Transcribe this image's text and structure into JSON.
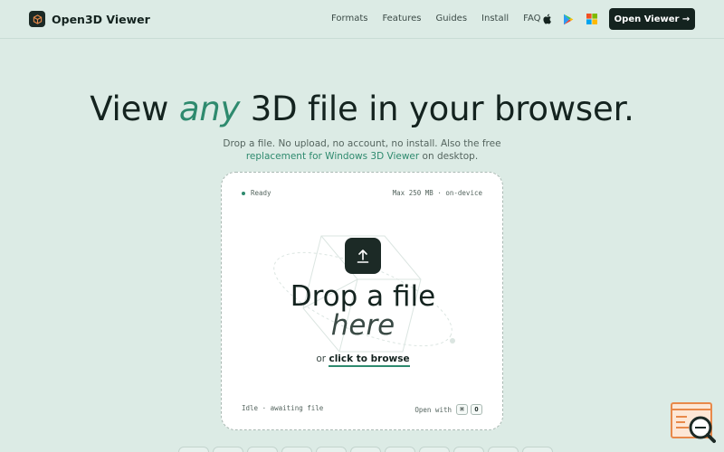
{
  "nav": {
    "brand": "Open3D Viewer",
    "links": [
      "Formats",
      "Features",
      "Guides",
      "Install",
      "FAQ"
    ],
    "platform_icons": [
      "apple-icon",
      "google-play-icon",
      "windows-icon"
    ],
    "cta": "Open Viewer →"
  },
  "hero": {
    "title_before": "View ",
    "title_accent": "any",
    "title_after": " 3D file in your browser.",
    "sub_line1": "Drop a file. No upload, no account, no install. Also the free",
    "sub_link": "replacement for Windows 3D Viewer",
    "sub_after": " on desktop."
  },
  "dropzone": {
    "status": "Ready",
    "limit": "Max 250 MB · on-device",
    "headline": "Drop a file",
    "headline_italic": "here",
    "browse_prefix": "or ",
    "browse_link": "click to browse",
    "idle": "Idle · awaiting file",
    "open_with": "Open with",
    "key1": "⌘",
    "key2": "O"
  },
  "colors": {
    "background": "#dcebe5",
    "accent": "#2e8a6e",
    "dark": "#14231f",
    "badge": "#e8894a"
  }
}
